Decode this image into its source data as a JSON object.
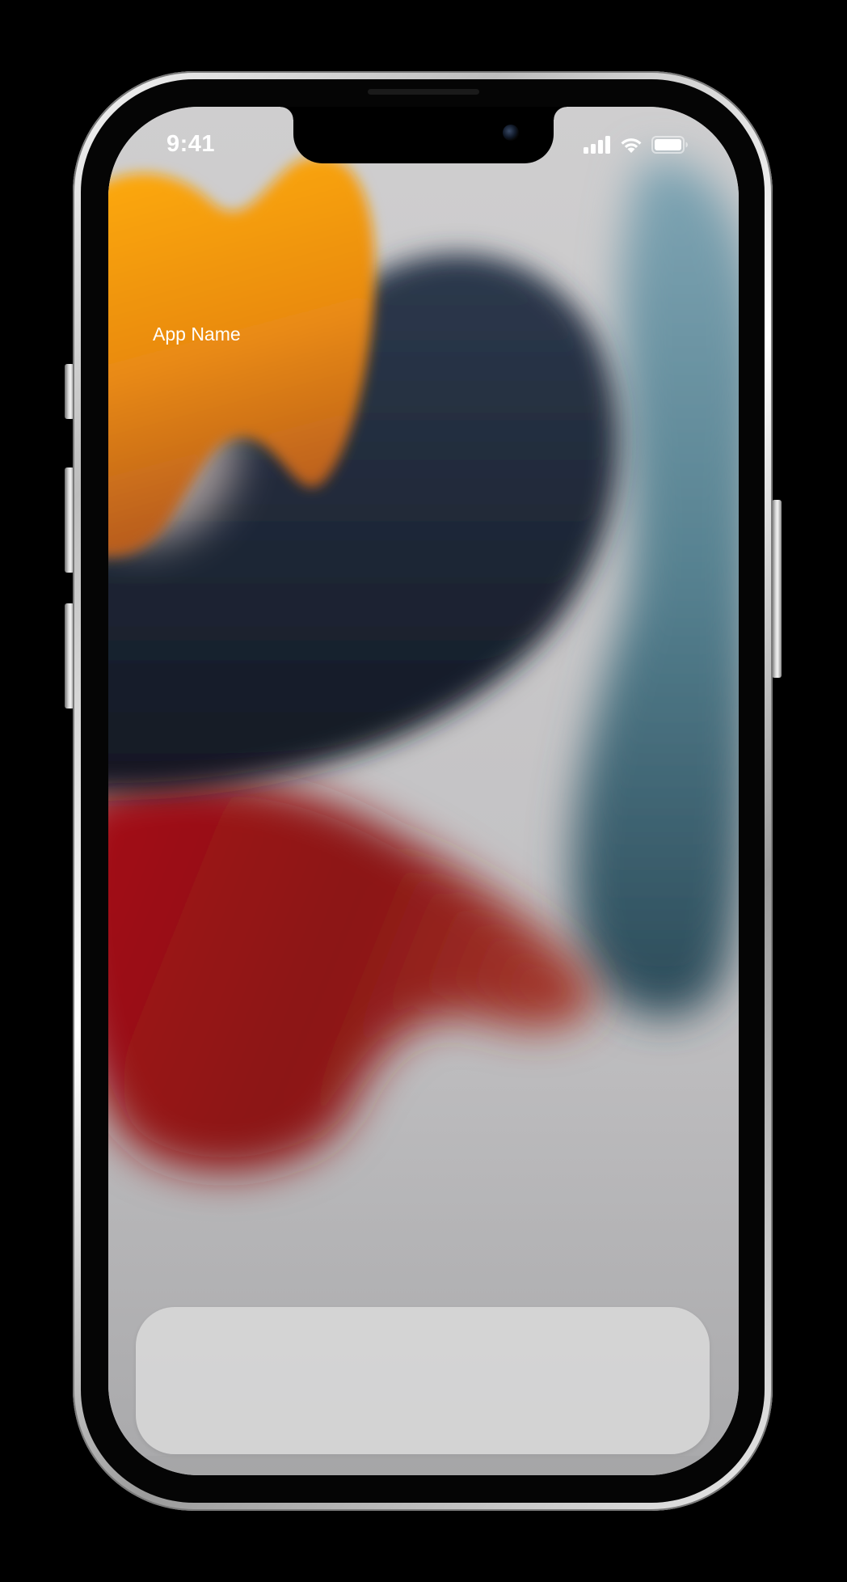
{
  "status_bar": {
    "time": "9:41",
    "signal_icon": "cellular-signal-icon",
    "wifi_icon": "wifi-icon",
    "battery_icon": "battery-icon"
  },
  "content": {
    "app_name": "App Name"
  },
  "colors": {
    "wallpaper_background": "#c9c8c9",
    "orange_blob": "#f5a00f",
    "navy_blob": "#1e2838",
    "teal_blob": "#4d7482",
    "red_blob": "#a31418",
    "text": "#ffffff"
  }
}
